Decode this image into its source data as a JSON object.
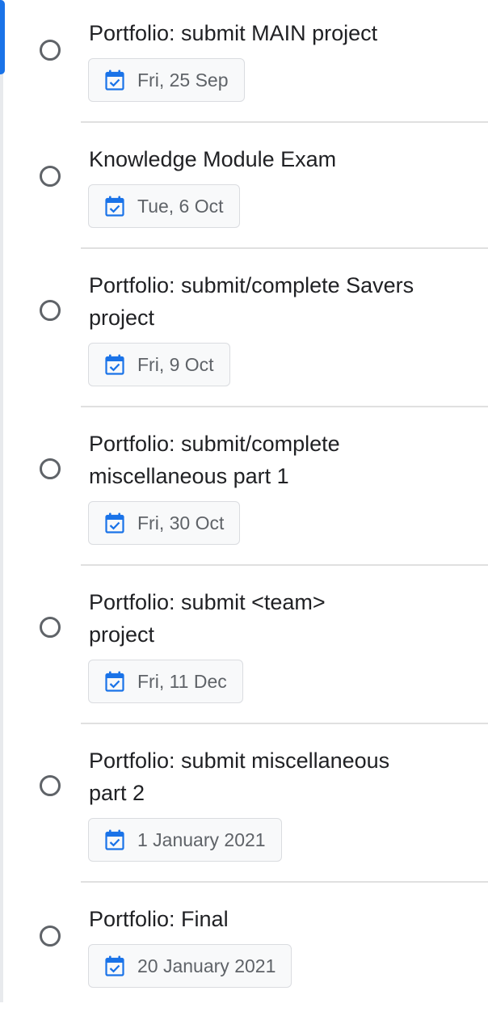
{
  "tasks": [
    {
      "title": "Portfolio: submit MAIN project",
      "due": "Fri, 25 Sep"
    },
    {
      "title": "Knowledge Module Exam",
      "due": "Tue, 6 Oct"
    },
    {
      "title": "Portfolio: submit/complete Savers project",
      "due": "Fri, 9 Oct"
    },
    {
      "title": "Portfolio: submit/complete miscellaneous part 1",
      "due": "Fri, 30 Oct"
    },
    {
      "title": "Portfolio: submit <team> project",
      "due": "Fri, 11 Dec"
    },
    {
      "title": "Portfolio: submit miscellaneous part 2",
      "due": "1 January 2021"
    },
    {
      "title": "Portfolio: Final",
      "due": "20 January 2021"
    }
  ],
  "icons": {
    "checkbox": "circle-checkbox-icon",
    "date": "calendar-check-icon"
  },
  "colors": {
    "accent": "#1a73e8",
    "checkbox_border": "#5f6368",
    "chip_background": "#f8f9fa",
    "chip_text": "#5f6368",
    "divider": "#e0e0e0"
  }
}
